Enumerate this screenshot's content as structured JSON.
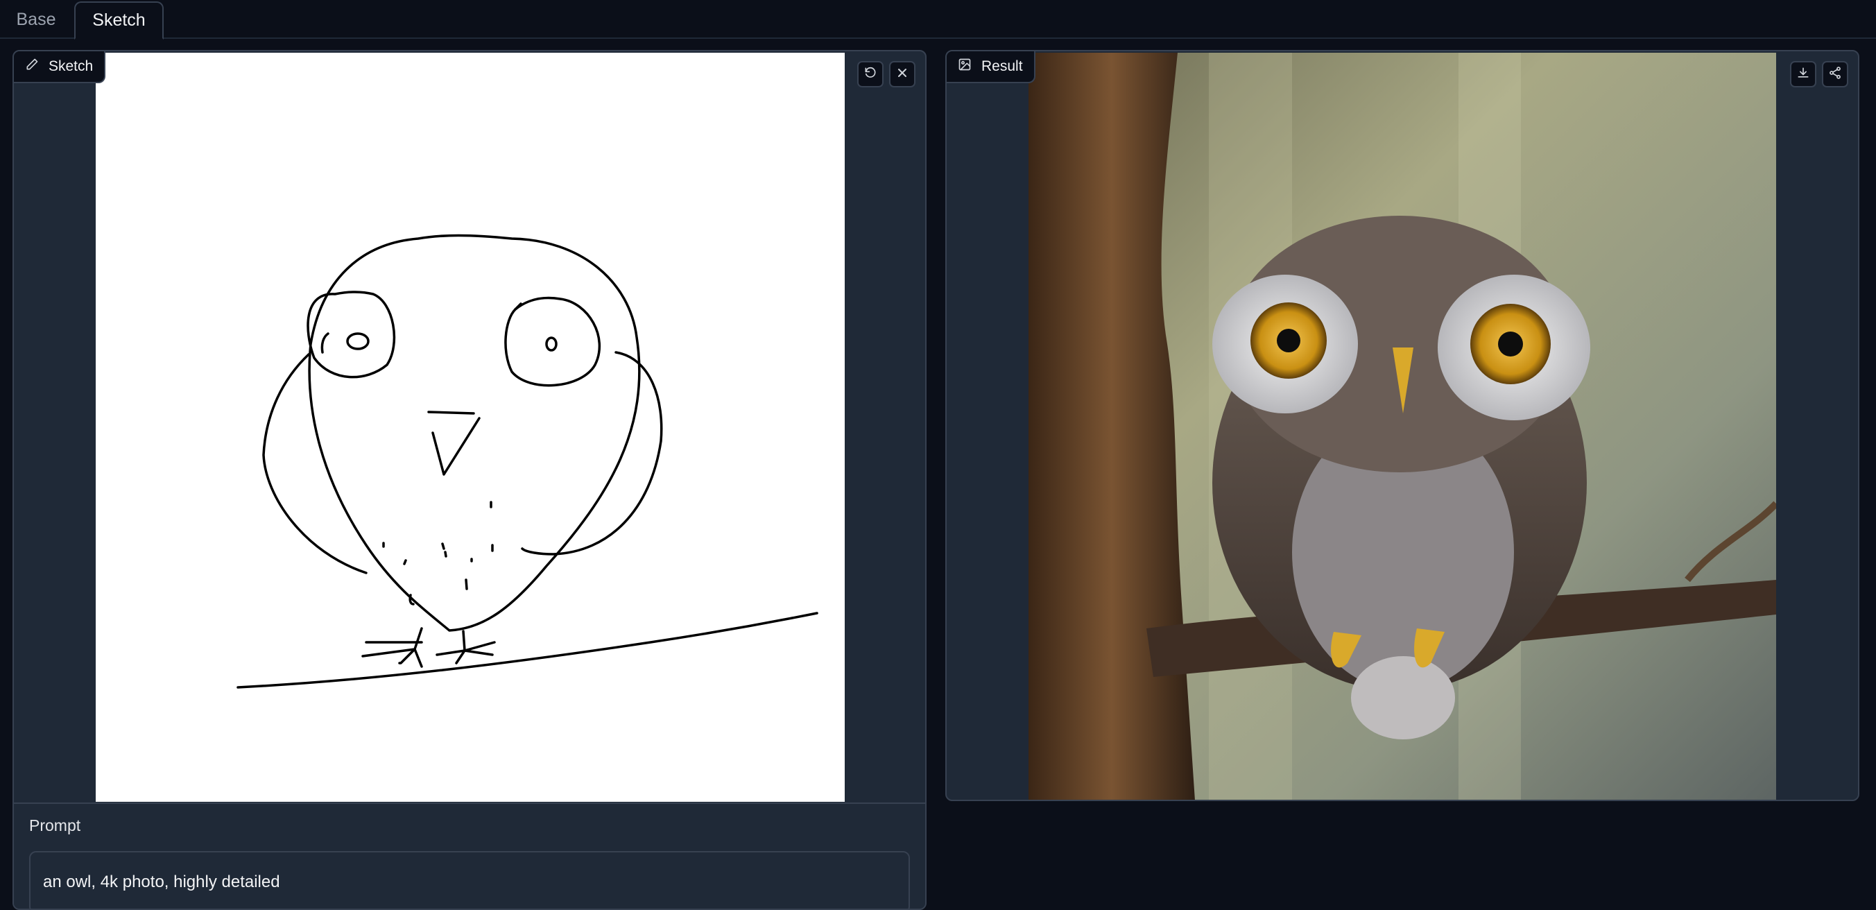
{
  "tabs": [
    {
      "label": "Base",
      "active": false
    },
    {
      "label": "Sketch",
      "active": true
    }
  ],
  "sketch_panel": {
    "label": "Sketch",
    "icons": [
      "pencil-icon",
      "undo-icon",
      "close-icon"
    ]
  },
  "result_panel": {
    "label": "Result",
    "icons": [
      "image-icon",
      "download-icon",
      "share-icon"
    ]
  },
  "prompt": {
    "label": "Prompt",
    "value": "an owl, 4k photo, highly detailed"
  },
  "colors": {
    "background": "#0b0f19",
    "panel": "#1f2937",
    "border": "#374151",
    "owl_eye": "#d4a017"
  }
}
